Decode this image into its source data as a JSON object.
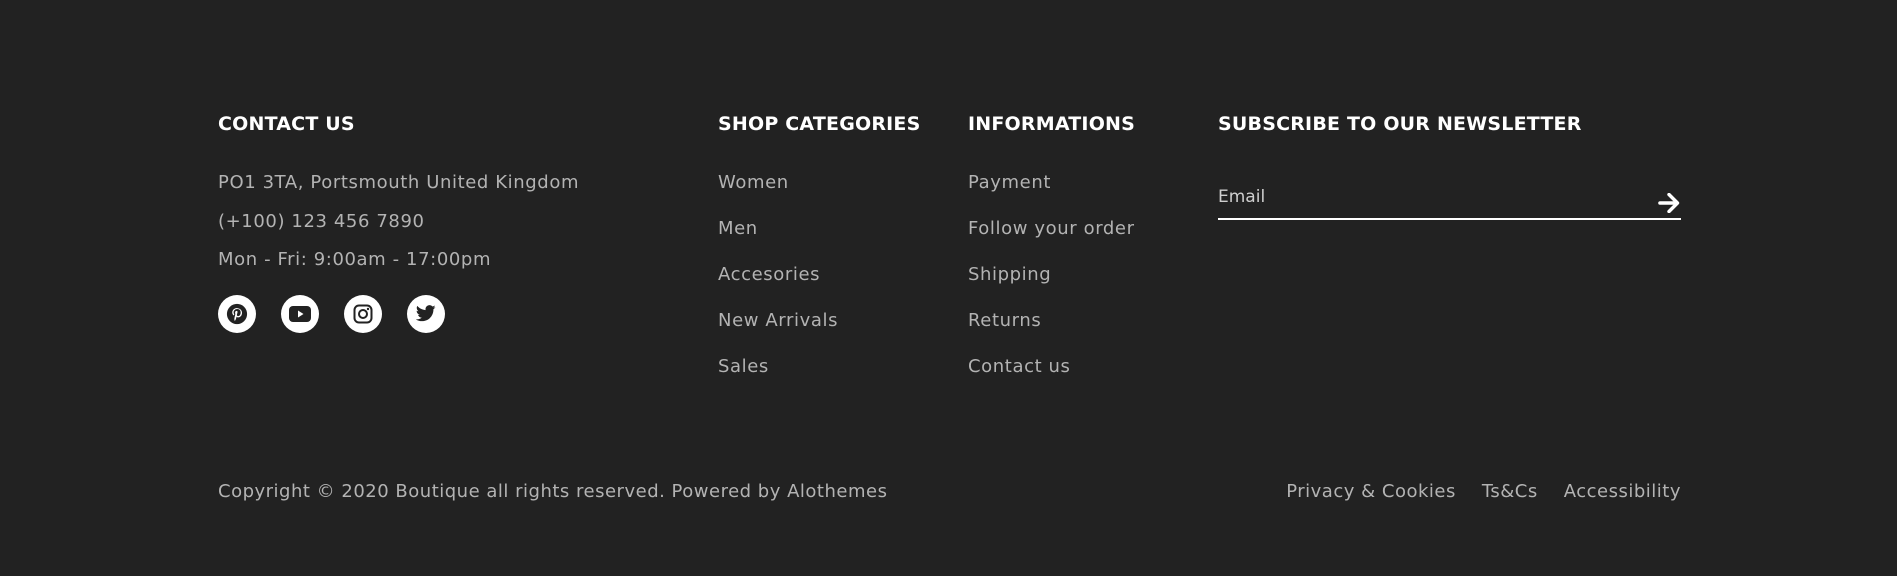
{
  "contact": {
    "heading": "CONTACT US",
    "address": "PO1 3TA, Portsmouth United Kingdom",
    "phone": "(+100) 123 456 7890",
    "hours": "Mon - Fri: 9:00am - 17:00pm",
    "social": [
      {
        "name": "pinterest-icon"
      },
      {
        "name": "youtube-icon"
      },
      {
        "name": "instagram-icon"
      },
      {
        "name": "twitter-icon"
      }
    ]
  },
  "shop": {
    "heading": "SHOP CATEGORIES",
    "items": [
      "Women",
      "Men",
      "Accesories",
      "New Arrivals",
      "Sales"
    ]
  },
  "info": {
    "heading": "INFORMATIONS",
    "items": [
      "Payment",
      "Follow your order",
      "Shipping",
      "Returns",
      "Contact us"
    ]
  },
  "newsletter": {
    "heading": "SUBSCRIBE TO OUR NEWSLETTER",
    "placeholder": "Email",
    "value": "",
    "submit_icon": "arrow-right-icon"
  },
  "bottom": {
    "copyright": "Copyright © 2020 Boutique all rights reserved. Powered by Alothemes",
    "links": [
      "Privacy & Cookies",
      "Ts&Cs",
      "Accessibility"
    ]
  },
  "colors": {
    "background": "#222222",
    "heading": "#ffffff",
    "text": "#b3b3b3",
    "icon_bg": "#ffffff",
    "icon_fg": "#222222"
  }
}
